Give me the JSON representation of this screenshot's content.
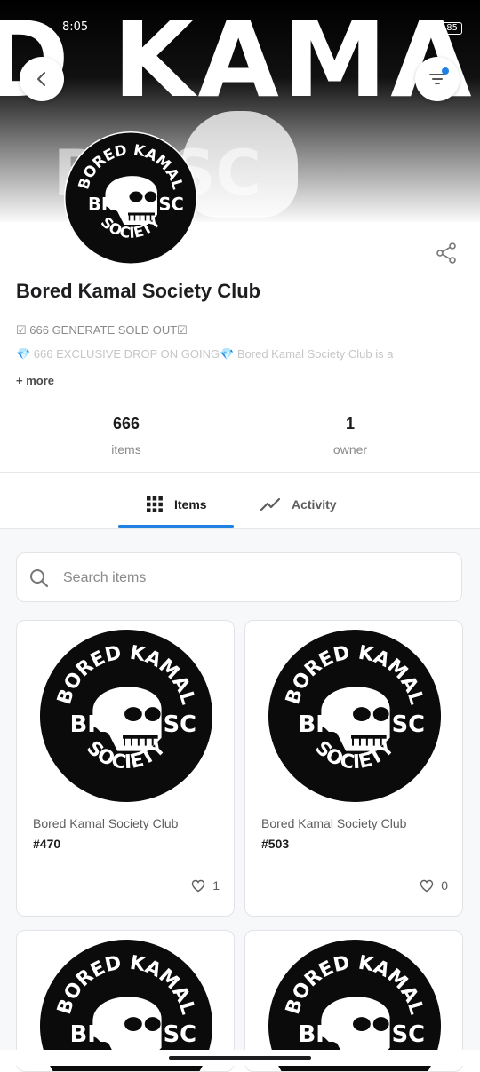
{
  "status_bar": {
    "time": "8:05",
    "battery": "85"
  },
  "banner": {
    "text": "D KAMAL SO",
    "subtext": "BK   SC"
  },
  "collection": {
    "logo_top": "BORED KAMAL",
    "logo_left": "BK",
    "logo_right": "SC",
    "logo_bottom": "SOCIETY",
    "title": "Bored Kamal Society Club",
    "description_line1": "☑ 666 GENERATE SOLD OUT☑",
    "description_line2_gem": "💎",
    "description_line2": " 666 EXCLUSIVE DROP ON GOING",
    "description_line2_tail": " Bored Kamal Society Club is a",
    "more_label": "+ more"
  },
  "stats": {
    "items_value": "666",
    "items_label": "items",
    "owner_value": "1",
    "owner_label": "owner"
  },
  "tabs": {
    "items_label": "Items",
    "activity_label": "Activity"
  },
  "search": {
    "placeholder": "Search items"
  },
  "cards": [
    {
      "collection": "Bored Kamal Society Club",
      "token": "#470",
      "likes": "1"
    },
    {
      "collection": "Bored Kamal Society Club",
      "token": "#503",
      "likes": "0"
    }
  ],
  "colors": {
    "accent": "#2081e2",
    "text": "#1d1d1f",
    "muted": "#8a8a8a"
  }
}
